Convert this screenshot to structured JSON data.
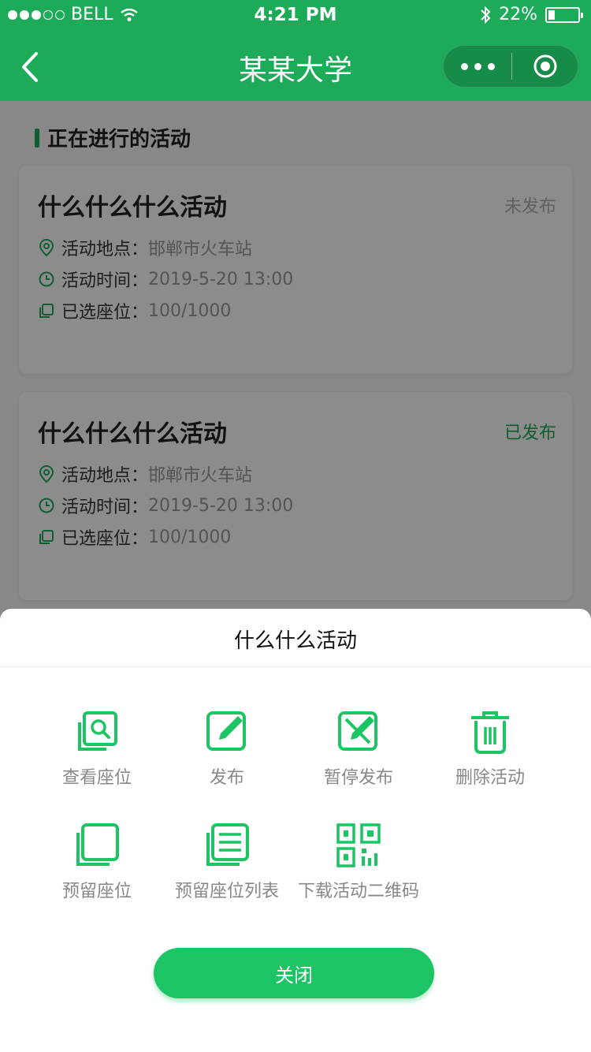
{
  "status_bar": {
    "carrier": "BELL",
    "time": "4:21 PM",
    "battery": "22%",
    "battery_level": 0.22
  },
  "nav": {
    "title": "某某大学"
  },
  "section_title": "正在进行的活动",
  "cards": [
    {
      "title": "什么什么什么活动",
      "status": "未发布",
      "location_label": "活动地点：",
      "location": "邯郸市火车站",
      "time_label": "活动时间：",
      "time": "2019-5-20 13:00",
      "seats_label": "已选座位：",
      "seats": "100/1000"
    },
    {
      "title": "什么什么什么活动",
      "status": "已发布",
      "location_label": "活动地点：",
      "location": "邯郸市火车站",
      "time_label": "活动时间：",
      "time": "2019-5-20 13:00",
      "seats_label": "已选座位：",
      "seats": "100/1000"
    }
  ],
  "sheet": {
    "title": "什么什么活动",
    "actions": [
      {
        "label": "查看座位",
        "icon": "view-seat-icon"
      },
      {
        "label": "发布",
        "icon": "edit-icon"
      },
      {
        "label": "暂停发布",
        "icon": "pause-publish-icon"
      },
      {
        "label": "删除活动",
        "icon": "trash-icon"
      },
      {
        "label": "预留座位",
        "icon": "square-icon"
      },
      {
        "label": "预留座位列表",
        "icon": "list-icon"
      },
      {
        "label": "下载活动二维码",
        "icon": "qrcode-icon"
      }
    ],
    "close_label": "关闭"
  },
  "colors": {
    "brand": "#1dab59",
    "button": "#1dc464",
    "unpublished": "#b0b0b0"
  }
}
